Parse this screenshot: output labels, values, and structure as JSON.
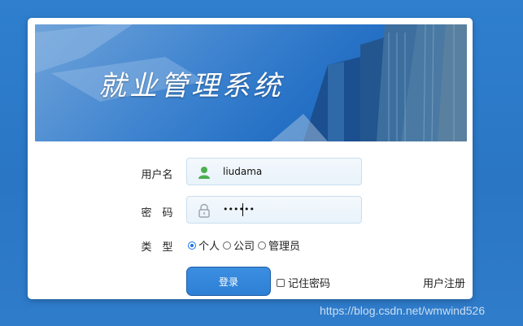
{
  "banner": {
    "title": "就业管理系统"
  },
  "form": {
    "username_label": "用户名",
    "username_value": "liudama",
    "password_label": "密　码",
    "password_value": "••••••",
    "type_label": "类　型",
    "type_options": [
      "个人",
      "公司",
      "管理员"
    ],
    "type_selected": "个人"
  },
  "actions": {
    "login_label": "登录",
    "remember_label": "记住密码",
    "register_label": "用户注册"
  },
  "watermark": "https://blog.csdn.net/wmwind526",
  "colors": {
    "page_bg": "#2f7fcf",
    "button": "#2d80d5",
    "user_icon": "#4caf50"
  },
  "icons": {
    "username": "user-icon",
    "password": "lock-icon"
  }
}
